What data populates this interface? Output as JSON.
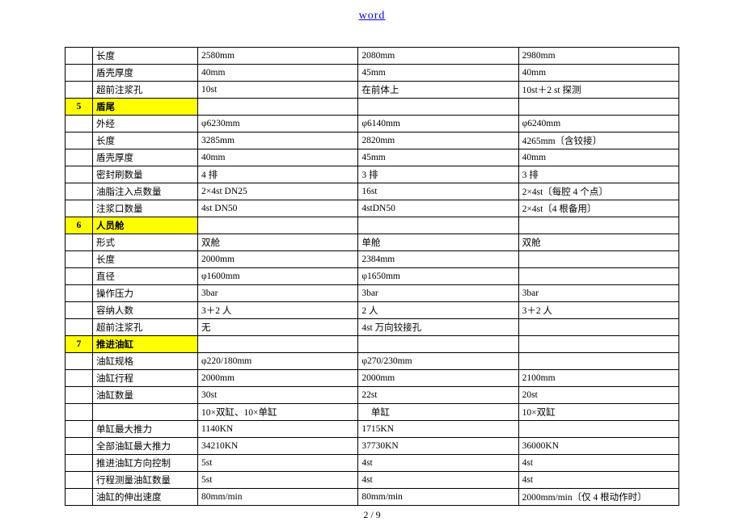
{
  "header": {
    "link": "word"
  },
  "footer": {
    "page": "2 / 9"
  },
  "rows": [
    {
      "num": "",
      "label": "长度",
      "v1": "2580mm",
      "v2": "2080mm",
      "v3": "2980mm"
    },
    {
      "num": "",
      "label": "盾壳厚度",
      "v1": "40mm",
      "v2": "45mm",
      "v3": "40mm"
    },
    {
      "num": "",
      "label": "超前注浆孔",
      "v1": "10st",
      "v2": "在前体上",
      "v3": "10st＋2 st 探测"
    },
    {
      "section": true,
      "num": "5",
      "label": "盾尾",
      "v1": "",
      "v2": "",
      "v3": ""
    },
    {
      "num": "",
      "label": "外经",
      "v1": "φ6230mm",
      "v2": "φ6140mm",
      "v3": "φ6240mm"
    },
    {
      "num": "",
      "label": "长度",
      "v1": "3285mm",
      "v2": "2820mm",
      "v3": "4265mm〔含铰接〕"
    },
    {
      "num": "",
      "label": "盾壳厚度",
      "v1": "40mm",
      "v2": "45mm",
      "v3": "40mm"
    },
    {
      "num": "",
      "label": "密封刷数量",
      "v1": "4 排",
      "v2": "3 排",
      "v3": "3 排"
    },
    {
      "num": "",
      "label": "油脂注入点数量",
      "v1": "2×4st DN25",
      "v2": "16st",
      "v3": "2×4st〔每腔 4 个点〕"
    },
    {
      "num": "",
      "label": "注浆口数量",
      "v1": "4st DN50",
      "v2": "4stDN50",
      "v3": "2×4st〔4 根备用〕"
    },
    {
      "section": true,
      "num": "6",
      "label": "人员舱",
      "v1": "",
      "v2": "",
      "v3": ""
    },
    {
      "num": "",
      "label": "形式",
      "v1": "双舱",
      "v2": "单舱",
      "v3": "双舱"
    },
    {
      "num": "",
      "label": "长度",
      "v1": "2000mm",
      "v2": "2384mm",
      "v3": ""
    },
    {
      "num": "",
      "label": "直径",
      "v1": "φ1600mm",
      "v2": "φ1650mm",
      "v3": ""
    },
    {
      "num": "",
      "label": "操作压力",
      "v1": "3bar",
      "v2": "3bar",
      "v3": "3bar"
    },
    {
      "num": "",
      "label": "容纳人数",
      "v1": "3＋2 人",
      "v2": "2 人",
      "v3": "3＋2 人"
    },
    {
      "num": "",
      "label": "超前注浆孔",
      "v1": "无",
      "v2": "4st 万向铰接孔",
      "v3": ""
    },
    {
      "section": true,
      "num": "7",
      "label": "推进油缸",
      "v1": "",
      "v2": "",
      "v3": ""
    },
    {
      "num": "",
      "label": "油缸规格",
      "v1": "φ220/180mm",
      "v2": "φ270/230mm",
      "v3": ""
    },
    {
      "num": "",
      "label": "油缸行程",
      "v1": "2000mm",
      "v2": "2000mm",
      "v3": "2100mm"
    },
    {
      "num": "",
      "label": "油缸数量",
      "v1": "30st",
      "v2": "22st",
      "v3": "20st"
    },
    {
      "num": "",
      "label": "",
      "v1": "10×双缸、10×单缸",
      "v2": "　单缸",
      "v3": "10×双缸"
    },
    {
      "num": "",
      "label": "单缸最大推力",
      "v1": "1140KN",
      "v2": "1715KN",
      "v3": ""
    },
    {
      "num": "",
      "label": "全部油缸最大推力",
      "v1": "34210KN",
      "v2": "37730KN",
      "v3": "36000KN"
    },
    {
      "num": "",
      "label": "推进油缸方向控制",
      "v1": "5st",
      "v2": "4st",
      "v3": "4st"
    },
    {
      "num": "",
      "label": "行程测量油缸数量",
      "v1": "5st",
      "v2": "4st",
      "v3": "4st"
    },
    {
      "num": "",
      "label": "油缸的伸出速度",
      "v1": "80mm/min",
      "v2": "80mm/min",
      "v3": "2000mm/min〔仅 4 根动作时〕"
    }
  ]
}
